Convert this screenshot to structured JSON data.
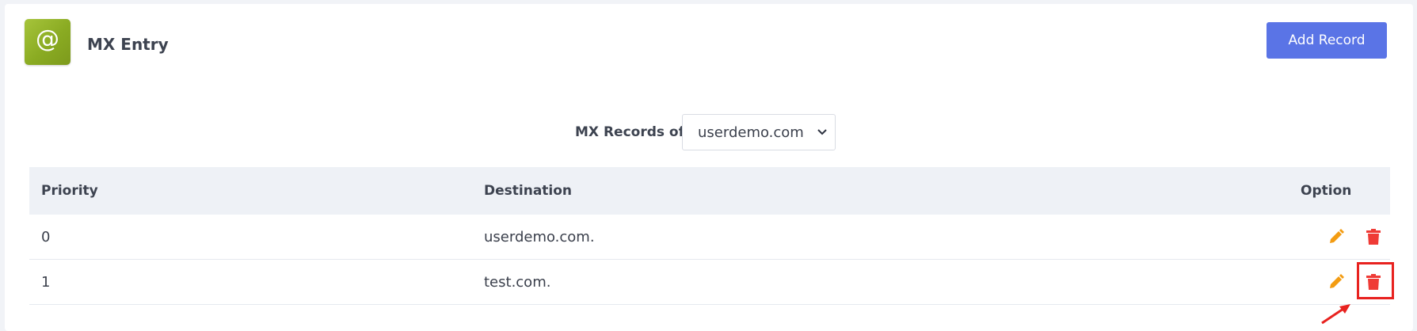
{
  "header": {
    "logo_glyph": "@",
    "title": "MX Entry",
    "add_button_label": "Add Record"
  },
  "filter": {
    "label": "MX Records of",
    "selected_domain": "userdemo.com"
  },
  "table": {
    "columns": [
      "Priority",
      "Destination",
      "Option"
    ],
    "rows": [
      {
        "priority": "0",
        "destination": "userdemo.com."
      },
      {
        "priority": "1",
        "destination": "test.com."
      }
    ]
  },
  "colors": {
    "accent": "#5a74e6",
    "logo": "#8aab22",
    "edit_icon": "#f39c12",
    "delete_icon": "#ef3b36",
    "annotation": "#e8221f"
  },
  "icons": {
    "edit": "pencil-icon",
    "delete": "trash-icon",
    "select_arrow": "chevron-down-icon"
  }
}
